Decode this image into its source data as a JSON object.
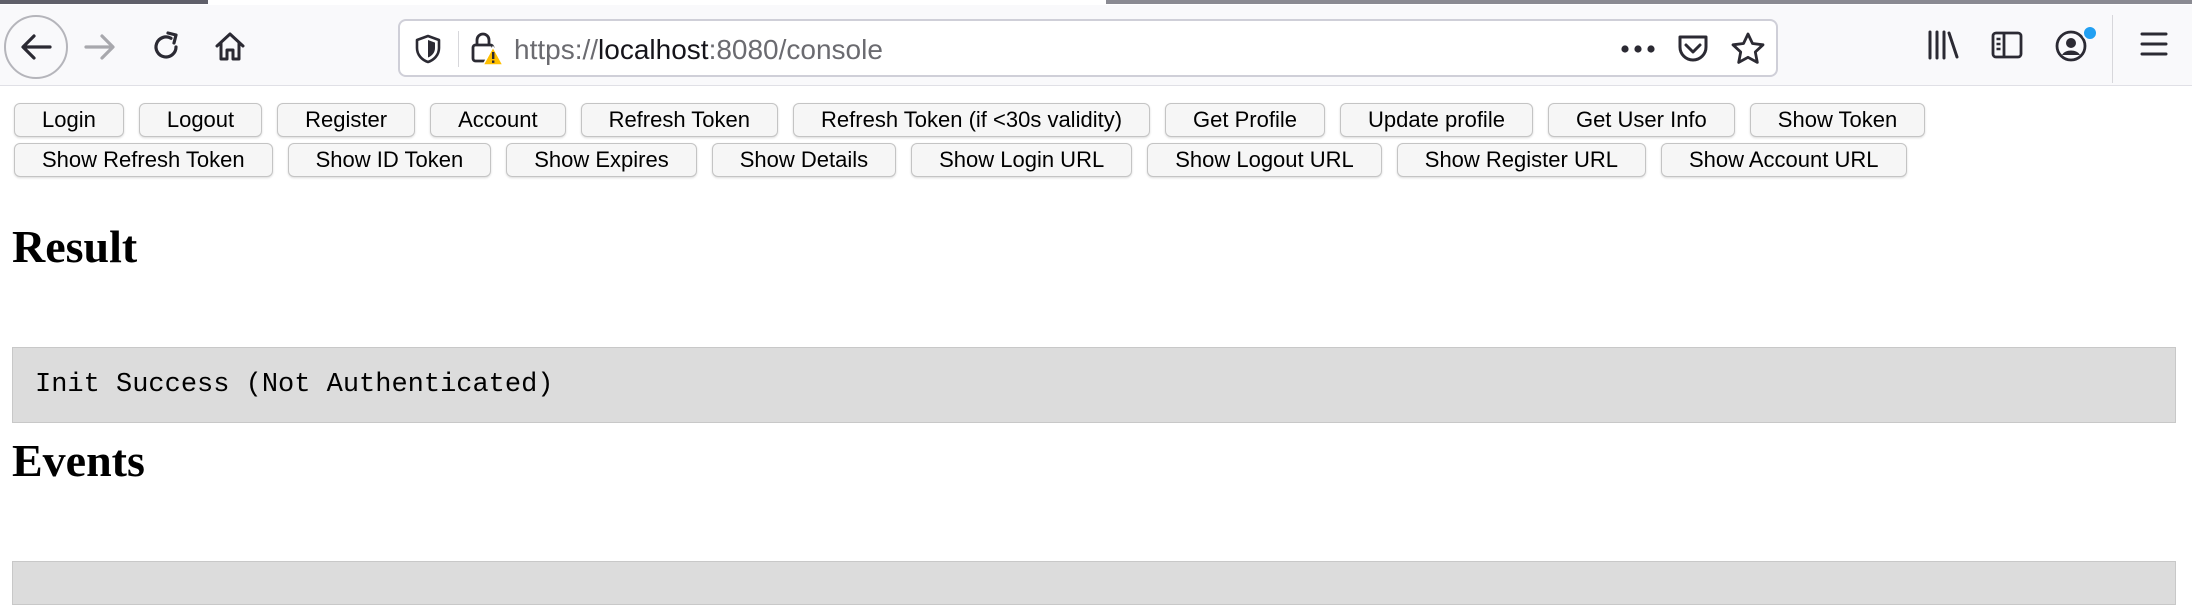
{
  "browser": {
    "url_scheme": "https://",
    "url_host": "localhost",
    "url_rest": ":8080/console",
    "icons": {
      "back": "back-arrow-icon",
      "forward": "forward-arrow-icon",
      "reload": "reload-icon",
      "home": "home-icon",
      "tracking": "shield-icon",
      "lock": "lock-warning-icon",
      "page_actions": "more-icon",
      "pocket": "pocket-icon",
      "bookmark": "star-icon",
      "library": "library-icon",
      "sidebar": "sidebar-icon",
      "account": "account-icon",
      "menu": "hamburger-menu-icon"
    },
    "badge_color": "#22a0f2"
  },
  "toolbar_row1": [
    {
      "label": "Login"
    },
    {
      "label": "Logout"
    },
    {
      "label": "Register"
    },
    {
      "label": "Account"
    },
    {
      "label": "Refresh Token"
    },
    {
      "label": "Refresh Token (if <30s validity)"
    },
    {
      "label": "Get Profile"
    },
    {
      "label": "Update profile"
    },
    {
      "label": "Get User Info"
    },
    {
      "label": "Show Token"
    }
  ],
  "toolbar_row2": [
    {
      "label": "Show Refresh Token"
    },
    {
      "label": "Show ID Token"
    },
    {
      "label": "Show Expires"
    },
    {
      "label": "Show Details"
    },
    {
      "label": "Show Login URL"
    },
    {
      "label": "Show Logout URL"
    },
    {
      "label": "Show Register URL"
    },
    {
      "label": "Show Account URL"
    }
  ],
  "result": {
    "heading": "Result",
    "output": "Init Success (Not Authenticated)"
  },
  "events": {
    "heading": "Events",
    "output": ""
  },
  "colors": {
    "panel_bg": "#dcdcdc",
    "button_bg": "#f6f6f6"
  }
}
